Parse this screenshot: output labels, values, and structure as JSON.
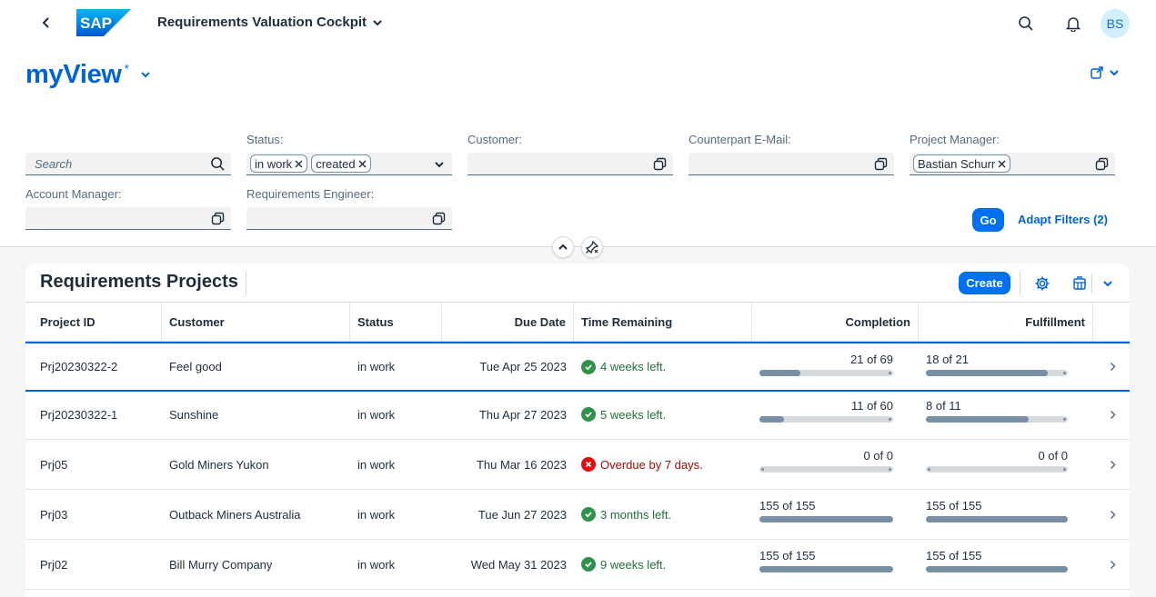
{
  "shell": {
    "logo_text": "SAP",
    "app_title": "Requirements Valuation Cockpit",
    "avatar_initials": "BS"
  },
  "variant": {
    "name": "myView",
    "modified_marker": "*"
  },
  "filters": {
    "search_placeholder": "Search",
    "status_label": "Status:",
    "status_tokens": [
      "in work",
      "created"
    ],
    "customer_label": "Customer:",
    "counterpart_label": "Counterpart E-Mail:",
    "project_manager_label": "Project Manager:",
    "project_manager_token": "Bastian Schurr",
    "account_manager_label": "Account Manager:",
    "requirements_engineer_label": "Requirements Engineer:",
    "go_label": "Go",
    "adapt_label": "Adapt Filters (2)"
  },
  "table": {
    "title": "Requirements Projects",
    "create_label": "Create",
    "columns": [
      "Project ID",
      "Customer",
      "Status",
      "Due Date",
      "Time Remaining",
      "Completion",
      "Fulfillment"
    ],
    "rows": [
      {
        "id": "Prj20230322-2",
        "customer": "Feel good",
        "status": "in work",
        "due": "Tue Apr 25 2023",
        "remaining": "4 weeks left.",
        "remaining_state": "ok",
        "completion": "21 of 69",
        "completion_value": 0.304,
        "fulfillment": "18 of 21",
        "fulfillment_value": 0.857
      },
      {
        "id": "Prj20230322-1",
        "customer": "Sunshine",
        "status": "in work",
        "due": "Thu Apr 27 2023",
        "remaining": "5 weeks left.",
        "remaining_state": "ok",
        "completion": "11 of 60",
        "completion_value": 0.183,
        "fulfillment": "8 of 11",
        "fulfillment_value": 0.727
      },
      {
        "id": "Prj05",
        "customer": "Gold Miners Yukon",
        "status": "in work",
        "due": "Thu Mar 16 2023",
        "remaining": "Overdue by 7 days.",
        "remaining_state": "bad",
        "completion": "0 of 0",
        "completion_value": 0,
        "fulfillment": "0 of 0",
        "fulfillment_value": 0
      },
      {
        "id": "Prj03",
        "customer": "Outback Miners Australia",
        "status": "in work",
        "due": "Tue Jun 27 2023",
        "remaining": "3 months left.",
        "remaining_state": "ok",
        "completion": "155 of 155",
        "completion_value": 1,
        "fulfillment": "155 of 155",
        "fulfillment_value": 1
      },
      {
        "id": "Prj02",
        "customer": "Bill Murry Company",
        "status": "in work",
        "due": "Wed May 31 2023",
        "remaining": "9 weeks left.",
        "remaining_state": "ok",
        "completion": "155 of 155",
        "completion_value": 1,
        "fulfillment": "155 of 155",
        "fulfillment_value": 1
      }
    ]
  },
  "colors": {
    "brand": "#0070f2",
    "link": "#0064d9",
    "success": "#30914c",
    "error": "#e90b0b"
  }
}
